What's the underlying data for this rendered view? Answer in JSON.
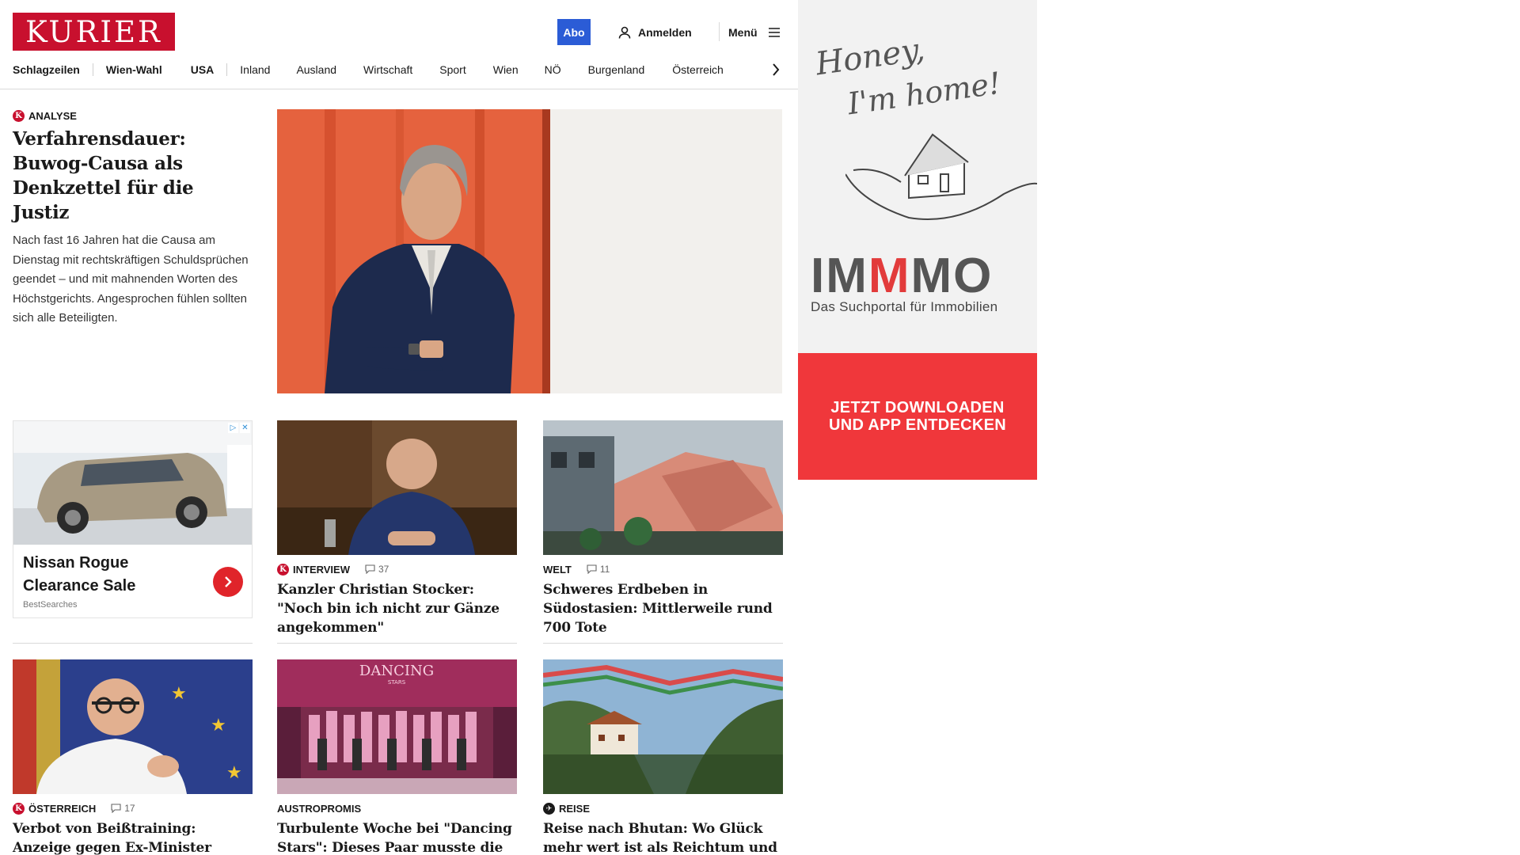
{
  "header": {
    "logo": "KURIER",
    "abo_label": "Abo",
    "login_label": "Anmelden",
    "menu_label": "Menü"
  },
  "nav": {
    "items": [
      "Schlagzeilen",
      "Wien-Wahl",
      "USA",
      "Inland",
      "Ausland",
      "Wirtschaft",
      "Sport",
      "Wien",
      "NÖ",
      "Burgenland",
      "Österreich"
    ]
  },
  "lead": {
    "kicker": "ANALYSE",
    "title": "Verfahrensdauer: Buwog-Causa als Denkzettel für die Justiz",
    "teaser": "Nach fast 16 Jahren hat die Causa am Dienstag mit rechtskräftigen Schuldsprüchen geendet – und mit mahnenden Worten des Höchstgerichts. Angesprochen fühlen sollten sich alle Beteiligten."
  },
  "ad_card": {
    "title": "Nissan Rogue Clearance Sale",
    "source": "BestSearches"
  },
  "cards": [
    {
      "kicker": "INTERVIEW",
      "comments": "37",
      "title": "Kanzler Christian Stocker: \"Noch bin ich nicht zur Gänze angekommen\""
    },
    {
      "kicker": "WELT",
      "comments": "11",
      "title": "Schweres Erdbeben in Südostasien: Mittlerweile rund 700 Tote"
    },
    {
      "kicker": "ÖSTERREICH",
      "comments": "17",
      "title": "Verbot von Beißtraining: Anzeige gegen Ex-Minister Rauch bei WKStA"
    },
    {
      "kicker": "AUSTROPROMIS",
      "comments": "",
      "title": "Turbulente Woche bei \"Dancing Stars\": Dieses Paar musste die Show verlassen"
    },
    {
      "kicker": "REISE",
      "comments": "",
      "title": "Reise nach Bhutan: Wo Glück mehr wert ist als Reichtum und Pomp"
    }
  ],
  "side_ad": {
    "script_line1": "Honey,",
    "script_line2": "I'm home!",
    "brand_a": "IM",
    "brand_m": "M",
    "brand_b": "MO",
    "tagline": "Das Suchportal für Immobilien",
    "cta_line1": "JETZT DOWNLOADEN",
    "cta_line2": "UND APP ENTDECKEN"
  },
  "dancing_logo": "DANCING",
  "dancing_logo_sub": "STARS",
  "colors": {
    "brand": "#c8102e",
    "abo": "#2b5cd6",
    "ad_cta": "#f0373b"
  }
}
